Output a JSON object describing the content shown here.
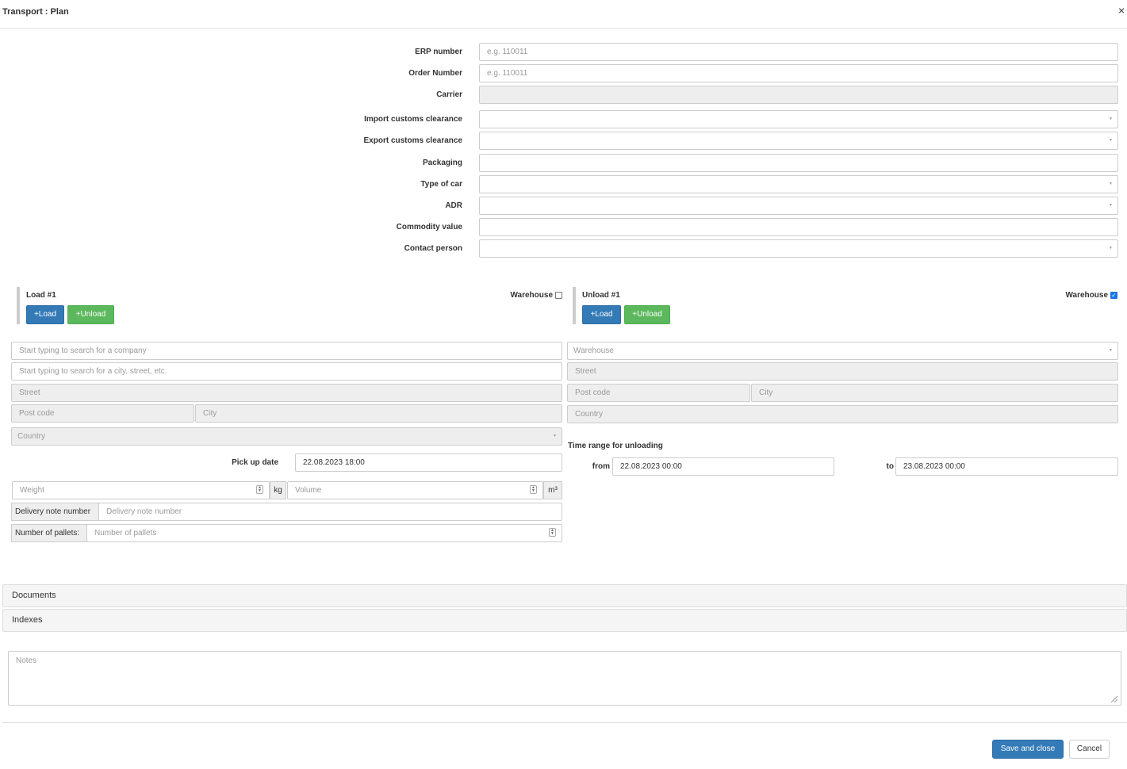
{
  "header": {
    "title": "Transport : Plan",
    "close": "×"
  },
  "form": {
    "erp_label": "ERP number",
    "erp_placeholder": "e.g. 110011",
    "order_label": "Order Number",
    "order_placeholder": "e.g. 110011",
    "carrier_label": "Carrier",
    "import_label": "Import customs clearance",
    "export_label": "Export customs clearance",
    "packaging_label": "Packaging",
    "car_label": "Type of car",
    "adr_label": "ADR",
    "commodity_label": "Commodity value",
    "contact_label": "Contact person"
  },
  "load": {
    "title": "Load #1",
    "warehouse_label": "Warehouse",
    "warehouse_checked": false,
    "add_load": "+Load",
    "add_unload": "+Unload",
    "company_placeholder": "Start typing to search for a company",
    "address_placeholder": "Start typing to search for a city, street, etc.",
    "street_placeholder": "Street",
    "postcode_placeholder": "Post code",
    "city_placeholder": "City",
    "country_placeholder": "Country",
    "pickup_label": "Pick up date",
    "pickup_value": "22.08.2023 18:00",
    "weight_placeholder": "Weight",
    "weight_unit": "kg",
    "volume_placeholder": "Volume",
    "volume_unit": "m³",
    "delivery_note_label": "Delivery note number",
    "delivery_note_placeholder": "Delivery note number",
    "pallets_label": "Number of pallets:",
    "pallets_placeholder": "Number of pallets"
  },
  "unload": {
    "title": "Unload #1",
    "warehouse_label": "Warehouse",
    "warehouse_checked": true,
    "add_load": "+Load",
    "add_unload": "+Unload",
    "warehouse_placeholder": "Warehouse",
    "street_placeholder": "Street",
    "postcode_placeholder": "Post code",
    "city_placeholder": "City",
    "country_placeholder": "Country",
    "time_range_label": "Time range for unloading",
    "from_label": "from",
    "from_value": "22.08.2023 00:00",
    "to_label": "to",
    "to_value": "23.08.2023 00:00"
  },
  "panels": {
    "documents": "Documents",
    "indexes": "Indexes"
  },
  "notes_placeholder": "Notes",
  "footer": {
    "save": "Save and close",
    "cancel": "Cancel"
  },
  "colors": {
    "primary": "#337ab7",
    "success": "#5cb85c",
    "readonly_bg": "#eeeeee",
    "panel_bg": "#f5f5f5"
  }
}
